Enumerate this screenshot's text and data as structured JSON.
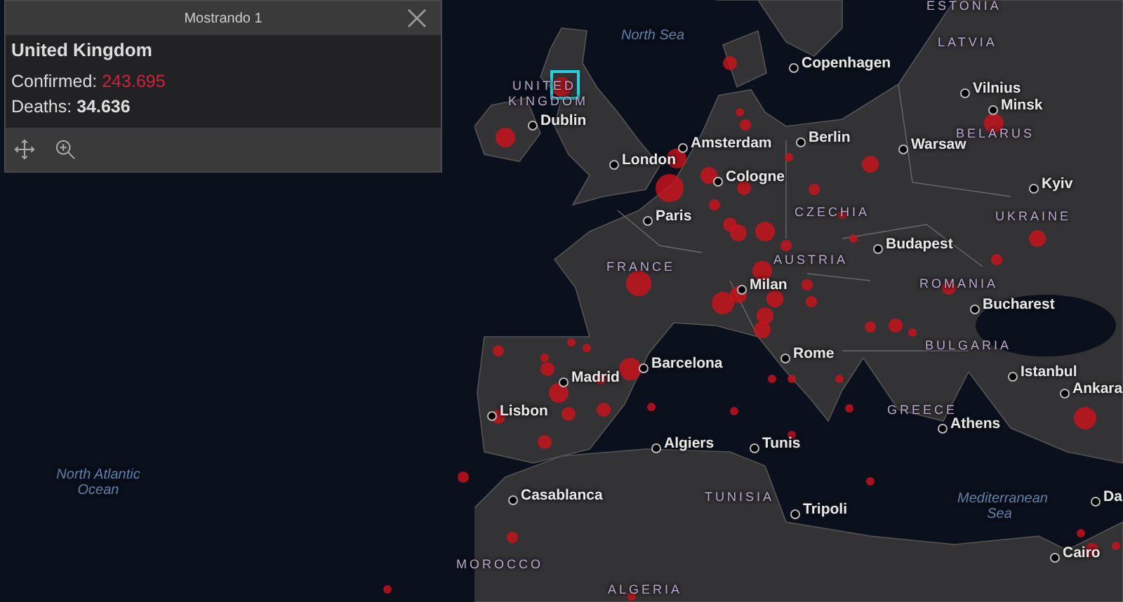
{
  "popup": {
    "title": "Mostrando 1",
    "name": "United Kingdom",
    "fields": [
      {
        "label": "Confirmed:",
        "value": "243.695",
        "kind": "highlight"
      },
      {
        "label": "Deaths:",
        "value": "34.636",
        "kind": "bold"
      }
    ]
  },
  "map": {
    "labels": [
      {
        "text": "ESTONIA",
        "kind": "country"
      },
      {
        "text": "North Sea",
        "kind": "sea"
      },
      {
        "text": "LATVIA",
        "kind": "country"
      },
      {
        "text": "Copenhagen",
        "kind": "city"
      },
      {
        "text": "UNITED",
        "kind": "country"
      },
      {
        "text": "KINGDOM",
        "kind": "country"
      },
      {
        "text": "Vilnius",
        "kind": "city"
      },
      {
        "text": "Minsk",
        "kind": "city"
      },
      {
        "text": "Dublin",
        "kind": "city"
      },
      {
        "text": "BELARUS",
        "kind": "country"
      },
      {
        "text": "Berlin",
        "kind": "city"
      },
      {
        "text": "Amsterdam",
        "kind": "city"
      },
      {
        "text": "Warsaw",
        "kind": "city"
      },
      {
        "text": "London",
        "kind": "city"
      },
      {
        "text": "Cologne",
        "kind": "city"
      },
      {
        "text": "Kyiv",
        "kind": "city"
      },
      {
        "text": "Paris",
        "kind": "city"
      },
      {
        "text": "CZECHIA",
        "kind": "country"
      },
      {
        "text": "UKRAINE",
        "kind": "country"
      },
      {
        "text": "Budapest",
        "kind": "city"
      },
      {
        "text": "AUSTRIA",
        "kind": "country"
      },
      {
        "text": "FRANCE",
        "kind": "country"
      },
      {
        "text": "ROMANIA",
        "kind": "country"
      },
      {
        "text": "Milan",
        "kind": "city"
      },
      {
        "text": "Bucharest",
        "kind": "city"
      },
      {
        "text": "BULGARIA",
        "kind": "country"
      },
      {
        "text": "Rome",
        "kind": "city"
      },
      {
        "text": "Barcelona",
        "kind": "city"
      },
      {
        "text": "Madrid",
        "kind": "city"
      },
      {
        "text": "Istanbul",
        "kind": "city"
      },
      {
        "text": "Ankara",
        "kind": "city"
      },
      {
        "text": "Lisbon",
        "kind": "city"
      },
      {
        "text": "GREECE",
        "kind": "country"
      },
      {
        "text": "Athens",
        "kind": "city"
      },
      {
        "text": "Algiers",
        "kind": "city"
      },
      {
        "text": "Tunis",
        "kind": "city"
      },
      {
        "text": "North Atlantic Ocean",
        "kind": "sea"
      },
      {
        "text": "Casablanca",
        "kind": "city"
      },
      {
        "text": "TUNISIA",
        "kind": "country"
      },
      {
        "text": "Tripoli",
        "kind": "city"
      },
      {
        "text": "Mediterranean Sea",
        "kind": "sea"
      },
      {
        "text": "Da",
        "kind": "city"
      },
      {
        "text": "Cairo",
        "kind": "city"
      },
      {
        "text": "MOROCCO",
        "kind": "country"
      },
      {
        "text": "ALGERIA",
        "kind": "country"
      }
    ]
  }
}
